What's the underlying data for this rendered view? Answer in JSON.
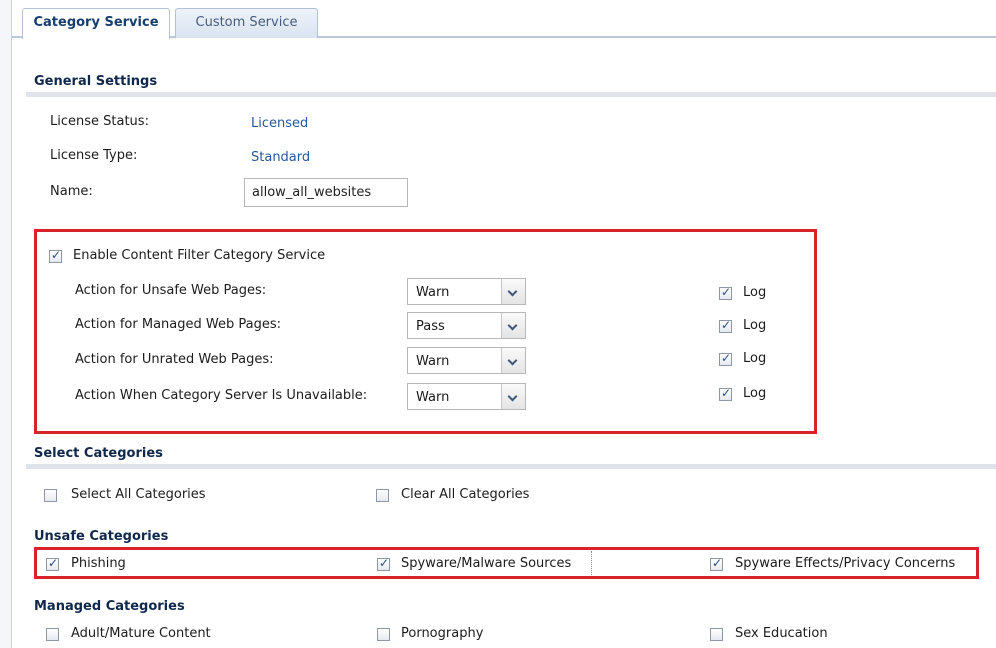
{
  "tabs": {
    "active": "Category Service",
    "inactive": "Custom Service"
  },
  "general": {
    "title": "General Settings",
    "license_status_label": "License Status:",
    "license_status_value": "Licensed",
    "license_type_label": "License Type:",
    "license_type_value": "Standard",
    "name_label": "Name:",
    "name_value": "allow_all_websites"
  },
  "category_service": {
    "enable_label": "Enable Content Filter Category Service",
    "enable_checked": true,
    "actions": [
      {
        "label": "Action for Unsafe Web Pages:",
        "value": "Warn",
        "log_label": "Log",
        "log_checked": true
      },
      {
        "label": "Action for Managed Web Pages:",
        "value": "Pass",
        "log_label": "Log",
        "log_checked": true
      },
      {
        "label": "Action for Unrated Web Pages:",
        "value": "Warn",
        "log_label": "Log",
        "log_checked": true
      },
      {
        "label": "Action When Category Server Is Unavailable:",
        "value": "Warn",
        "log_label": "Log",
        "log_checked": true
      }
    ]
  },
  "select_categories": {
    "title": "Select Categories",
    "select_all": "Select All Categories",
    "clear_all": "Clear All Categories"
  },
  "unsafe": {
    "title": "Unsafe Categories",
    "items": [
      {
        "label": "Phishing",
        "checked": true
      },
      {
        "label": "Spyware/Malware Sources",
        "checked": true
      },
      {
        "label": "Spyware Effects/Privacy Concerns",
        "checked": true
      }
    ]
  },
  "managed": {
    "title": "Managed Categories",
    "items": [
      {
        "label": "Adult/Mature Content",
        "checked": false
      },
      {
        "label": "Pornography",
        "checked": false
      },
      {
        "label": "Sex Education",
        "checked": false
      }
    ]
  },
  "colors": {
    "highlight": "#d8232a",
    "value_text": "#27579b",
    "section_title": "#10284c"
  }
}
